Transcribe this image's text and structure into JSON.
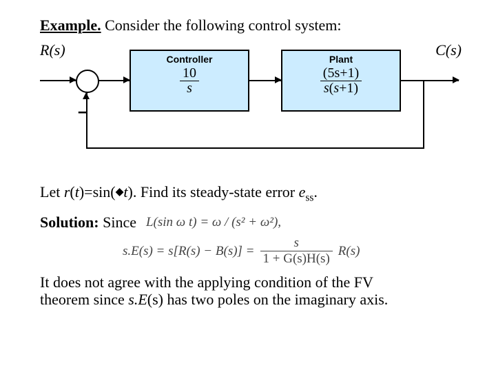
{
  "title_bold": "Example.",
  "title_rest": " Consider the following control system:",
  "input_label": "R(s)",
  "output_label": "C(s)",
  "controller": {
    "label": "Controller",
    "num": "10",
    "den": "s"
  },
  "plant": {
    "label": "Plant",
    "num": "(5s+1)",
    "den": "s(s+1)"
  },
  "minus": "–",
  "let_prefix": "Let ",
  "let_rt": "r",
  "let_t": "t",
  "let_eq": ")=sin(",
  "let_wt": "t",
  "let_suffix": "). Find its steady-state error ",
  "ess_e": "e",
  "ess_ss": "ss",
  "period": ".",
  "solution_bold": "Solution:",
  "solution_since": " Since",
  "lap_eq": "L(sin ω t) = ω / (s² + ω²),",
  "eE_left": "s.E(s) = s[R(s) − B(s)] =",
  "eE_num": "s",
  "eE_den": "1 + G(s)H(s)",
  "eE_right": "R(s)",
  "final_line1": "It does not agree with the applying condition of the FV",
  "final_line2_a": "theorem since ",
  "final_line2_b": "s.E",
  "final_line2_c": "(s)",
  "final_line2_d": " has two poles on the imaginary axis."
}
